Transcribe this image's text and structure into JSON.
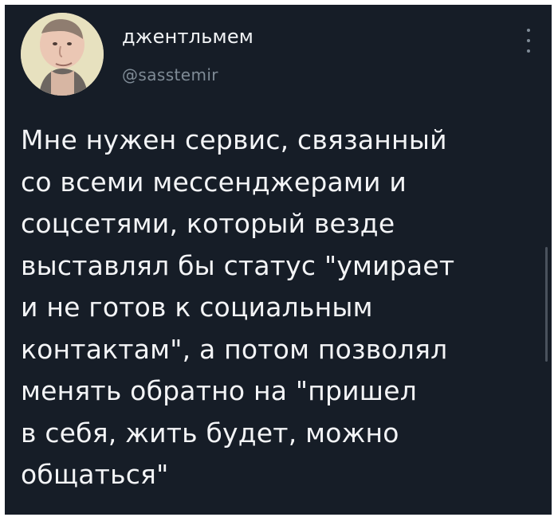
{
  "tweet": {
    "display_name": "джентльмем",
    "username": "@sasstemir",
    "text": "Мне нужен сервис, связанный\nсо всеми мессенджерами и\nсоцсетями, который везде\nвыставлял бы статус \"умирает\nи не готов к социальным\nконтактам\", а потом позволял\nменять обратно на \"пришел\nв себя, жить будет, можно\nобщаться\""
  },
  "icons": {
    "more_menu": "more-vertical-icon",
    "avatar": "user-avatar"
  },
  "colors": {
    "background": "#161d27",
    "text": "#f3f4f6",
    "muted_text": "#7f8b96",
    "scrollbar": "#4d5560"
  }
}
